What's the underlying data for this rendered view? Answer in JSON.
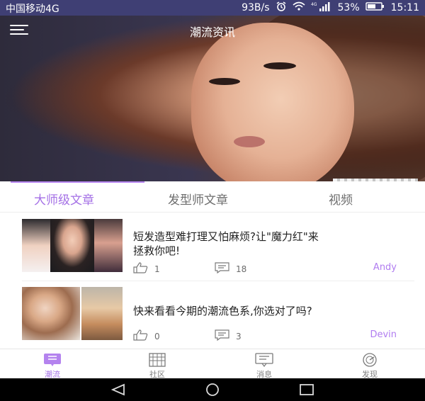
{
  "status_bar": {
    "carrier": "中国移动4G",
    "speed": "93B/s",
    "battery": "53%",
    "time": "15:11",
    "network_label": "4G"
  },
  "header": {
    "title": "潮流资讯",
    "carousel": {
      "page_count": 5,
      "active_index": 0
    }
  },
  "tabs": [
    {
      "label": "大师级文章",
      "active": true
    },
    {
      "label": "发型师文章",
      "active": false
    },
    {
      "label": "视频",
      "active": false
    }
  ],
  "articles": [
    {
      "title_line1": "短发造型难打理又怕麻烦?让\"魔力红\"来",
      "title_line2": "拯救你吧!",
      "likes": "1",
      "comments": "18",
      "author": "Andy"
    },
    {
      "title_line1": "快来看看今期的潮流色系,你选对了吗?",
      "title_line2": "",
      "likes": "0",
      "comments": "3",
      "author": "Devin"
    }
  ],
  "bottom_nav": [
    {
      "label": "潮流",
      "icon": "list-icon",
      "active": true
    },
    {
      "label": "社区",
      "icon": "building-icon",
      "active": false
    },
    {
      "label": "消息",
      "icon": "message-icon",
      "active": false
    },
    {
      "label": "发现",
      "icon": "compass-icon",
      "active": false
    }
  ],
  "colors": {
    "accent": "#a470e6",
    "status_bar": "#3f3f74",
    "divider": "#eeeeee"
  }
}
